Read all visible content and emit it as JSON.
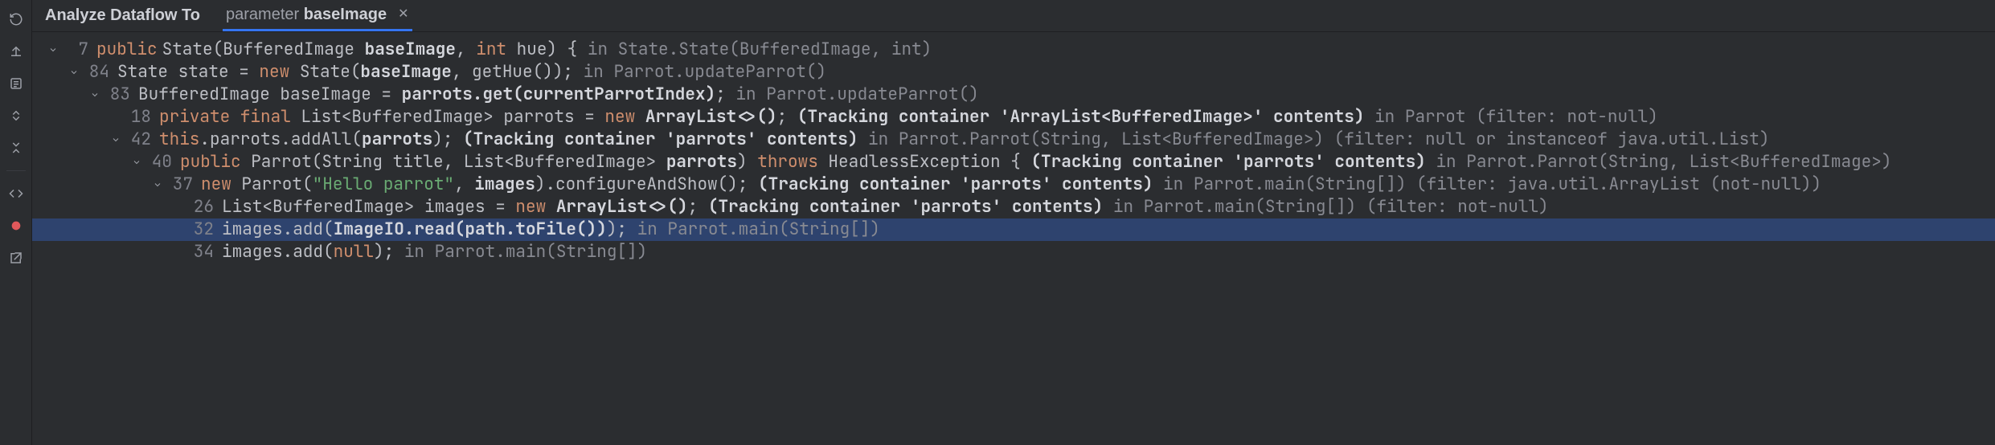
{
  "header": {
    "title": "Analyze Dataflow To",
    "tab_param_kw": "parameter",
    "tab_param_name": "baseImage"
  },
  "rows": [
    {
      "indent": 0,
      "chevron": true,
      "line": "7",
      "tokens": [
        {
          "t": "public",
          "c": "kw"
        },
        {
          "t": " ",
          "c": "sp"
        },
        {
          "t": "State(BufferedImage ",
          "c": "txt"
        },
        {
          "t": "baseImage",
          "c": "bold"
        },
        {
          "t": ", ",
          "c": "txt"
        },
        {
          "t": "int",
          "c": "kw"
        },
        {
          "t": " hue) { ",
          "c": "txt"
        },
        {
          "t": "in State.State(BufferedImage, int)",
          "c": "dim"
        }
      ]
    },
    {
      "indent": 1,
      "chevron": true,
      "line": "84",
      "tokens": [
        {
          "t": "State state = ",
          "c": "txt"
        },
        {
          "t": "new",
          "c": "kw"
        },
        {
          "t": " State(",
          "c": "txt"
        },
        {
          "t": "baseImage",
          "c": "bold"
        },
        {
          "t": ", getHue()); ",
          "c": "txt"
        },
        {
          "t": "in Parrot.updateParrot()",
          "c": "dim"
        }
      ]
    },
    {
      "indent": 2,
      "chevron": true,
      "line": "83",
      "tokens": [
        {
          "t": "BufferedImage baseImage = ",
          "c": "txt"
        },
        {
          "t": "parrots.get(currentParrotIndex)",
          "c": "bold"
        },
        {
          "t": "; ",
          "c": "txt"
        },
        {
          "t": "in Parrot.updateParrot()",
          "c": "dim"
        }
      ]
    },
    {
      "indent": 3,
      "chevron": false,
      "line": "18",
      "tokens": [
        {
          "t": "private final",
          "c": "kw"
        },
        {
          "t": " List<BufferedImage> parrots = ",
          "c": "txt"
        },
        {
          "t": "new",
          "c": "kw"
        },
        {
          "t": " ",
          "c": "txt"
        },
        {
          "t": "ArrayList<>()",
          "c": "bold"
        },
        {
          "t": "; ",
          "c": "txt"
        },
        {
          "t": "(Tracking container 'ArrayList<BufferedImage>' contents)",
          "c": "bold"
        },
        {
          "t": " in Parrot (filter: not-null)",
          "c": "dim"
        }
      ]
    },
    {
      "indent": 3,
      "chevron": true,
      "line": "42",
      "tokens": [
        {
          "t": "this",
          "c": "kw"
        },
        {
          "t": ".parrots.addAll(",
          "c": "txt"
        },
        {
          "t": "parrots",
          "c": "bold"
        },
        {
          "t": "); ",
          "c": "txt"
        },
        {
          "t": "(Tracking container 'parrots' contents)",
          "c": "bold"
        },
        {
          "t": " in Parrot.Parrot(String, List<BufferedImage>) (filter: null or instanceof java.util.List)",
          "c": "dim"
        }
      ]
    },
    {
      "indent": 4,
      "chevron": true,
      "line": "40",
      "tokens": [
        {
          "t": "public",
          "c": "kw"
        },
        {
          "t": " Parrot(String title, List<BufferedImage> ",
          "c": "txt"
        },
        {
          "t": "parrots",
          "c": "bold"
        },
        {
          "t": ") ",
          "c": "txt"
        },
        {
          "t": "throws",
          "c": "kw"
        },
        {
          "t": " HeadlessException { ",
          "c": "txt"
        },
        {
          "t": "(Tracking container 'parrots' contents)",
          "c": "bold"
        },
        {
          "t": " in Parrot.Parrot(String, List<BufferedImage>)",
          "c": "dim"
        }
      ]
    },
    {
      "indent": 5,
      "chevron": true,
      "line": "37",
      "tokens": [
        {
          "t": "new",
          "c": "kw"
        },
        {
          "t": " Parrot(",
          "c": "txt"
        },
        {
          "t": "\"Hello parrot\"",
          "c": "str"
        },
        {
          "t": ", ",
          "c": "txt"
        },
        {
          "t": "images",
          "c": "bold"
        },
        {
          "t": ").configureAndShow(); ",
          "c": "txt"
        },
        {
          "t": "(Tracking container 'parrots' contents)",
          "c": "bold"
        },
        {
          "t": " in Parrot.main(String[]) (filter: java.util.ArrayList (not-null))",
          "c": "dim"
        }
      ]
    },
    {
      "indent": 6,
      "chevron": false,
      "line": "26",
      "tokens": [
        {
          "t": "List<BufferedImage> images = ",
          "c": "txt"
        },
        {
          "t": "new",
          "c": "kw"
        },
        {
          "t": " ",
          "c": "txt"
        },
        {
          "t": "ArrayList<>()",
          "c": "bold"
        },
        {
          "t": "; ",
          "c": "txt"
        },
        {
          "t": "(Tracking container 'parrots' contents)",
          "c": "bold"
        },
        {
          "t": " in Parrot.main(String[]) (filter: not-null)",
          "c": "dim"
        }
      ]
    },
    {
      "indent": 6,
      "chevron": false,
      "line": "32",
      "selected": true,
      "tokens": [
        {
          "t": "images.add(",
          "c": "txt"
        },
        {
          "t": "ImageIO.read(path.toFile())",
          "c": "bold"
        },
        {
          "t": "); ",
          "c": "txt"
        },
        {
          "t": "in Parrot.main(String[])",
          "c": "dim"
        }
      ]
    },
    {
      "indent": 6,
      "chevron": false,
      "line": "34",
      "tokens": [
        {
          "t": "images.add(",
          "c": "txt"
        },
        {
          "t": "null",
          "c": "kw"
        },
        {
          "t": "); ",
          "c": "txt"
        },
        {
          "t": "in Parrot.main(String[])",
          "c": "dim"
        }
      ]
    }
  ]
}
